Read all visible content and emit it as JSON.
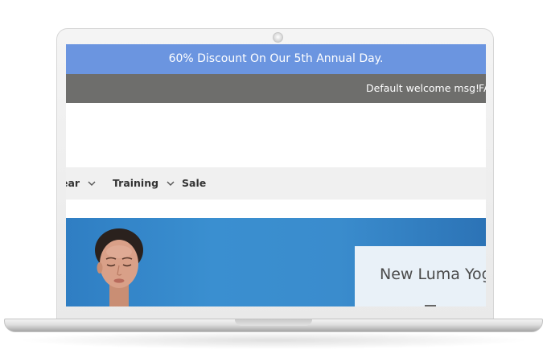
{
  "promo": {
    "text": "60% Discount On Our 5th Annual Day."
  },
  "top_bar": {
    "welcome": "Default welcome msg!",
    "faq": "FA"
  },
  "nav": {
    "items": [
      {
        "label": "ear",
        "has_dropdown": true
      },
      {
        "label": "Training",
        "has_dropdown": true
      },
      {
        "label": "Sale",
        "has_dropdown": false
      }
    ]
  },
  "hero": {
    "title": "New Luma Yoga"
  },
  "colors": {
    "promo_bg": "#6b95e0",
    "top_bar_bg": "#6e6e6c",
    "nav_bg": "#f0f0f0",
    "hero_bg": "#3a8fd0",
    "hero_card_bg": "#e9f1f8"
  }
}
